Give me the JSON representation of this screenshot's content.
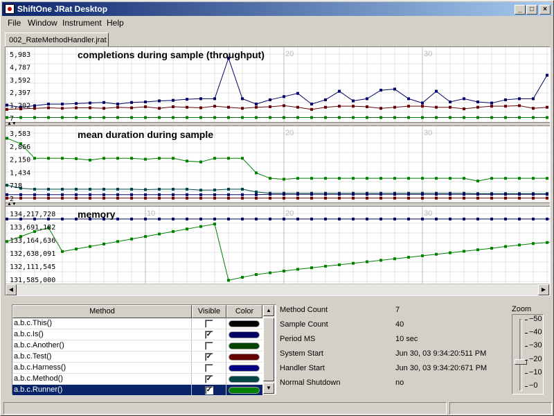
{
  "window": {
    "title": "ShiftOne JRat Desktop"
  },
  "menu": [
    "File",
    "Window",
    "Instrument",
    "Help"
  ],
  "tab": {
    "label": "002_RateMethodHandler.jrat"
  },
  "charts": [
    {
      "title": "completions during sample (throughput)",
      "y_ticks": [
        "5,983",
        "4,787",
        "3,592",
        "2,397",
        "1,202",
        "7"
      ],
      "x_ticks": [
        "20",
        "30"
      ]
    },
    {
      "title": "mean duration during sample",
      "y_ticks": [
        "3,583",
        "2,866",
        "2,150",
        "1,434",
        "718",
        "2"
      ],
      "x_ticks": [
        "20",
        "30"
      ]
    },
    {
      "title": "memory",
      "y_ticks": [
        "134,217,728",
        "133,691,182",
        "133,164,636",
        "132,638,091",
        "132,111,545",
        "131,585,000"
      ],
      "x_ticks": [
        "10",
        "20",
        "30"
      ]
    }
  ],
  "chart_data": [
    {
      "type": "line",
      "title": "completions during sample (throughput)",
      "ylim": [
        7,
        5983
      ],
      "x": [
        1,
        2,
        3,
        4,
        5,
        6,
        7,
        8,
        9,
        10,
        11,
        12,
        13,
        14,
        15,
        16,
        17,
        18,
        19,
        20,
        21,
        22,
        23,
        24,
        25,
        26,
        27,
        28,
        29,
        30,
        31,
        32,
        33,
        34,
        35,
        36,
        37,
        38,
        39,
        40
      ],
      "series": [
        {
          "color": "#000066",
          "values": [
            1202,
            1000,
            1150,
            1300,
            1300,
            1350,
            1400,
            1450,
            1300,
            1450,
            1500,
            1600,
            1650,
            1750,
            1800,
            1800,
            5600,
            1800,
            1300,
            1700,
            2000,
            2300,
            1300,
            1700,
            2500,
            1600,
            1800,
            2600,
            2700,
            1800,
            1400,
            2500,
            1500,
            1800,
            1500,
            1400,
            1700,
            1800,
            1800,
            4000
          ]
        },
        {
          "color": "#660000",
          "values": [
            800,
            850,
            900,
            950,
            900,
            950,
            950,
            900,
            1000,
            950,
            1050,
            900,
            1050,
            1000,
            950,
            1100,
            1000,
            900,
            1000,
            1050,
            1150,
            1000,
            800,
            1000,
            1100,
            1100,
            1050,
            900,
            1000,
            1100,
            1100,
            1000,
            1000,
            850,
            1000,
            1100,
            1100,
            1150,
            900,
            1000
          ]
        },
        {
          "color": "#008000",
          "values": [
            40,
            40,
            40,
            40,
            40,
            40,
            40,
            40,
            40,
            40,
            40,
            40,
            40,
            40,
            40,
            40,
            40,
            40,
            40,
            40,
            40,
            40,
            40,
            40,
            40,
            40,
            40,
            40,
            40,
            40,
            40,
            40,
            40,
            40,
            40,
            40,
            40,
            40,
            40,
            40
          ]
        }
      ]
    },
    {
      "type": "line",
      "title": "mean duration during sample",
      "ylim": [
        2,
        3583
      ],
      "x": [
        1,
        2,
        3,
        4,
        5,
        6,
        7,
        8,
        9,
        10,
        11,
        12,
        13,
        14,
        15,
        16,
        17,
        18,
        19,
        20,
        21,
        22,
        23,
        24,
        25,
        26,
        27,
        28,
        29,
        30,
        31,
        32,
        33,
        34,
        35,
        36,
        37,
        38,
        39,
        40
      ],
      "series": [
        {
          "color": "#008000",
          "values": [
            3300,
            3000,
            2200,
            2200,
            2200,
            2180,
            2100,
            2200,
            2200,
            2200,
            2150,
            2200,
            2200,
            2050,
            2000,
            2200,
            2200,
            2200,
            1400,
            1100,
            1050,
            1100,
            1100,
            1100,
            1100,
            1100,
            1100,
            1100,
            1100,
            1100,
            1100,
            1100,
            1100,
            1100,
            950,
            1100,
            1100,
            1100,
            1100,
            1100
          ]
        },
        {
          "color": "#004444",
          "values": [
            720,
            550,
            500,
            500,
            500,
            500,
            500,
            500,
            500,
            500,
            480,
            500,
            500,
            500,
            450,
            460,
            500,
            500,
            350,
            280,
            280,
            280,
            280,
            280,
            280,
            280,
            280,
            280,
            280,
            280,
            280,
            280,
            280,
            280,
            260,
            260,
            260,
            260,
            260,
            260
          ]
        },
        {
          "color": "#000066",
          "values": [
            200,
            200,
            200,
            200,
            200,
            200,
            200,
            200,
            200,
            200,
            200,
            200,
            200,
            200,
            200,
            200,
            200,
            200,
            200,
            220,
            220,
            220,
            220,
            220,
            220,
            220,
            220,
            220,
            220,
            220,
            220,
            220,
            220,
            220,
            220,
            220,
            220,
            220,
            220,
            220
          ]
        },
        {
          "color": "#660000",
          "values": [
            10,
            10,
            10,
            10,
            10,
            10,
            10,
            10,
            10,
            10,
            10,
            10,
            10,
            10,
            10,
            10,
            10,
            10,
            10,
            10,
            10,
            10,
            10,
            10,
            10,
            10,
            10,
            10,
            10,
            10,
            10,
            10,
            10,
            10,
            10,
            10,
            10,
            10,
            10,
            10
          ]
        }
      ]
    },
    {
      "type": "line",
      "title": "memory",
      "ylim": [
        131585000,
        134217728
      ],
      "x": [
        1,
        2,
        3,
        4,
        5,
        6,
        7,
        8,
        9,
        10,
        11,
        12,
        13,
        14,
        15,
        16,
        17,
        18,
        19,
        20,
        21,
        22,
        23,
        24,
        25,
        26,
        27,
        28,
        29,
        30,
        31,
        32,
        33,
        34,
        35,
        36,
        37,
        38,
        39,
        40,
        41
      ],
      "series": [
        {
          "color": "#000066",
          "values": [
            134000000,
            134000000,
            134000000,
            134000000,
            134000000,
            134000000,
            134000000,
            134000000,
            134000000,
            134000000,
            134000000,
            134000000,
            134000000,
            134000000,
            134000000,
            134000000,
            134000000,
            134000000,
            134000000,
            134000000,
            134000000,
            134000000,
            134000000,
            134000000,
            134000000,
            134000000,
            134000000,
            134000000,
            134000000,
            134000000,
            134000000,
            134000000,
            134000000,
            134000000,
            134000000,
            134000000,
            134000000,
            134000000,
            134000000,
            134000000,
            134000000
          ]
        },
        {
          "color": "#008000",
          "values": [
            133100000,
            133300000,
            133500000,
            133650000,
            132700000,
            132800000,
            132900000,
            133000000,
            133100000,
            133200000,
            133300000,
            133400000,
            133500000,
            133600000,
            133700000,
            133800000,
            131550000,
            131670000,
            131780000,
            131850000,
            131920000,
            131990000,
            132050000,
            132110000,
            132170000,
            132230000,
            132290000,
            132350000,
            132410000,
            132470000,
            132530000,
            132590000,
            132650000,
            132710000,
            132770000,
            132830000,
            132900000,
            132960000,
            133020000,
            133060000,
            133150000
          ]
        }
      ]
    }
  ],
  "methods": {
    "headers": [
      "Method",
      "Visible",
      "Color"
    ],
    "rows": [
      {
        "name": "a.b.c.This()",
        "visible": false,
        "color": "#000000",
        "selected": false
      },
      {
        "name": "a.b.c.Is()",
        "visible": true,
        "color": "#000066",
        "selected": false
      },
      {
        "name": "a.b.c.Another()",
        "visible": false,
        "color": "#004400",
        "selected": false
      },
      {
        "name": "a.b.c.Test()",
        "visible": true,
        "color": "#660000",
        "selected": false
      },
      {
        "name": "a.b.c.Harness()",
        "visible": false,
        "color": "#000080",
        "selected": false
      },
      {
        "name": "a.b.c.Method()",
        "visible": true,
        "color": "#004444",
        "selected": false
      },
      {
        "name": "a.b.c.Runner()",
        "visible": true,
        "color": "#008000",
        "selected": true
      }
    ]
  },
  "info": [
    {
      "key": "Method Count",
      "value": "7"
    },
    {
      "key": "Sample Count",
      "value": "40"
    },
    {
      "key": "Period MS",
      "value": "10 sec"
    },
    {
      "key": "System Start",
      "value": "Jun 30, 03  9:34:20:511 PM"
    },
    {
      "key": "Handler Start",
      "value": "Jun 30, 03  9:34:20:671 PM"
    },
    {
      "key": "Normal Shutdown",
      "value": "no"
    }
  ],
  "zoom": {
    "label": "Zoom",
    "ticks": [
      "−50",
      "−40",
      "−30",
      "−20",
      "−10",
      "−0"
    ],
    "value": 15
  }
}
